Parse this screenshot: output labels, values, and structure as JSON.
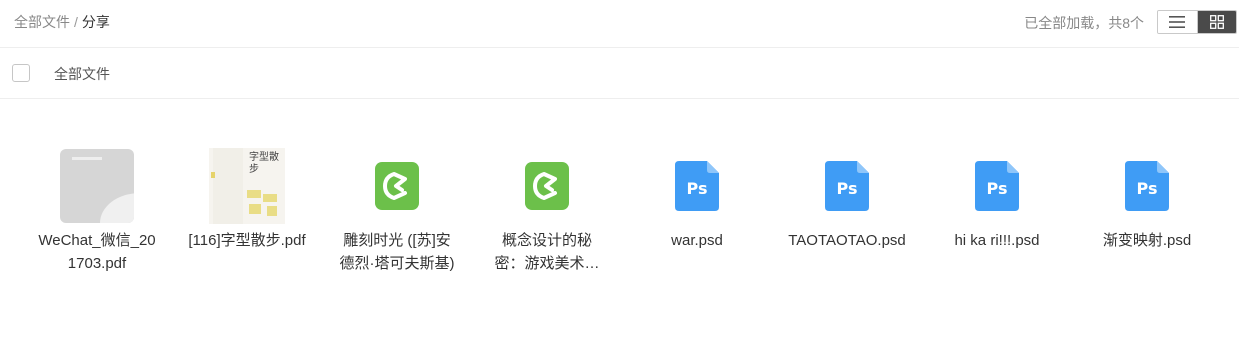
{
  "breadcrumb": {
    "root": "全部文件",
    "separator": "/",
    "current": "分享"
  },
  "status_text": "已全部加载，共8个",
  "view_toggle": {
    "list_icon": "list-icon",
    "grid_icon": "grid-icon",
    "active": "grid"
  },
  "header": {
    "select_all_label": "全部文件"
  },
  "files": [
    {
      "name": "WeChat_微信_201703.pdf",
      "icon": "pdf-thumbnail"
    },
    {
      "name": "[116]字型散步.pdf",
      "icon": "pdf-thumbnail",
      "cover_text": "字型散步"
    },
    {
      "name": "雕刻时光 ([苏]安德烈·塔可夫斯基)",
      "icon": "epub-icon"
    },
    {
      "name": "概念设计的秘密：游戏美术设计",
      "icon": "epub-icon"
    },
    {
      "name": "war.psd",
      "icon": "psd-icon"
    },
    {
      "name": "TAOTAOTAO.psd",
      "icon": "psd-icon"
    },
    {
      "name": "hi ka ri!!!.psd",
      "icon": "psd-icon"
    },
    {
      "name": "渐变映射.psd",
      "icon": "psd-icon"
    }
  ],
  "colors": {
    "epub": "#6cc04a",
    "psd": "#3f9cf5",
    "toggle_active": "#4a4a4a"
  }
}
